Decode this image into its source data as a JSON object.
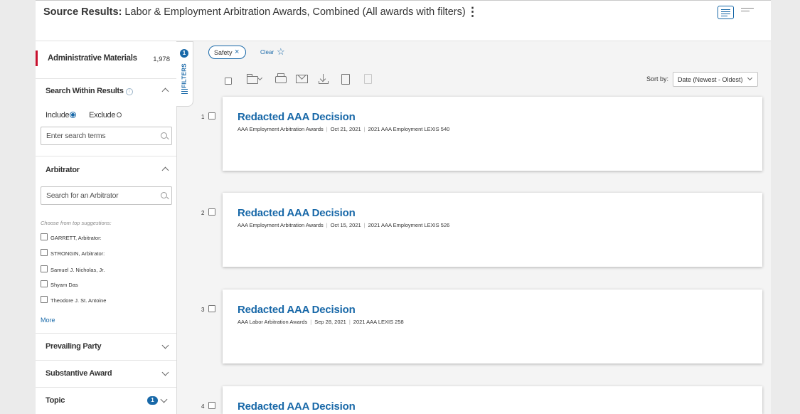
{
  "header": {
    "title_prefix": "Source Results:",
    "title_rest": " Labor & Employment Arbitration Awards, Combined (All awards with filters)",
    "more_icon": "kebab-icon"
  },
  "sidebar": {
    "admin": {
      "label": "Administrative Materials",
      "count": "1,978"
    },
    "search_within": {
      "title": "Search Within Results",
      "include_label": "Include",
      "exclude_label": "Exclude",
      "include_selected": true,
      "placeholder": "Enter search terms"
    },
    "arbitrator": {
      "title": "Arbitrator",
      "placeholder": "Search for an Arbitrator",
      "suggestions_header": "Choose from top suggestions:",
      "options": [
        "GARRETT, Arbitrator:",
        "STRONGIN, Arbitrator:",
        "Samuel J. Nicholas, Jr.",
        "Shyam Das",
        "Theodore J. St. Antoine"
      ],
      "more_label": "More"
    },
    "prevailing_party": {
      "title": "Prevailing Party"
    },
    "substantive_award": {
      "title": "Substantive Award"
    },
    "topic": {
      "title": "Topic",
      "badge": "1"
    }
  },
  "filters_tab": {
    "label": "FILTERS",
    "badge": "1"
  },
  "filter_bar": {
    "chip_label": "Safety",
    "clear_label": "Clear"
  },
  "sort": {
    "label": "Sort by:",
    "value": "Date (Newest - Oldest)"
  },
  "results": [
    {
      "num": "1",
      "title": "Redacted AAA Decision",
      "source": "AAA Employment Arbitration Awards",
      "date": "Oct 21, 2021",
      "cite": "2021 AAA Employment LEXIS 540"
    },
    {
      "num": "2",
      "title": "Redacted AAA Decision",
      "source": "AAA Employment Arbitration Awards",
      "date": "Oct 15, 2021",
      "cite": "2021 AAA Employment LEXIS 526"
    },
    {
      "num": "3",
      "title": "Redacted AAA Decision",
      "source": "AAA Labor Arbitration Awards",
      "date": "Sep 28, 2021",
      "cite": "2021 AAA LEXIS 258"
    },
    {
      "num": "4",
      "title": "Redacted AAA Decision",
      "source": "",
      "date": "",
      "cite": ""
    }
  ],
  "colors": {
    "accent": "#1868a8",
    "admin_marker": "#c8102e"
  }
}
